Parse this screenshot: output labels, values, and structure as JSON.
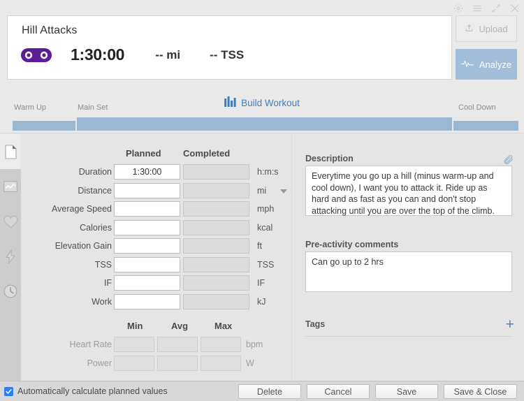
{
  "window": {
    "controls": [
      {
        "name": "gear-icon",
        "label": "Settings"
      },
      {
        "name": "menu-icon",
        "label": "Menu"
      },
      {
        "name": "expand-icon",
        "label": "Expand"
      },
      {
        "name": "close-icon",
        "label": "Close"
      }
    ]
  },
  "header": {
    "title": "Hill Attacks",
    "sport_icon": "bike-chain-icon",
    "sport_color": "#5b1e96",
    "duration": "1:30:00",
    "distance": "-- mi",
    "tss": "-- TSS",
    "upload_label": "Upload",
    "analyze_label": "Analyze",
    "analyze_color": "#a1bedb"
  },
  "workout_bar": {
    "build_label": "Build Workout",
    "build_color": "#3e7cba",
    "segments": [
      {
        "label": "Warm Up"
      },
      {
        "label": "Main Set"
      },
      {
        "label": "Cool Down"
      }
    ],
    "segment_color": "#9bb8d3"
  },
  "rail": {
    "items": [
      {
        "name": "document-icon",
        "label": "Summary",
        "active": true
      },
      {
        "name": "chart-icon",
        "label": "Graphs",
        "active": false
      },
      {
        "name": "heart-icon",
        "label": "Heart Rate",
        "active": false
      },
      {
        "name": "lightning-icon",
        "label": "Power",
        "active": false
      },
      {
        "name": "clock-icon",
        "label": "Time",
        "active": false
      }
    ]
  },
  "metrics": {
    "col_planned": "Planned",
    "col_completed": "Completed",
    "rows": [
      {
        "label": "Duration",
        "planned": "1:30:00",
        "completed": "",
        "unit": "h:m:s",
        "dropdown": false
      },
      {
        "label": "Distance",
        "planned": "",
        "completed": "",
        "unit": "mi",
        "dropdown": true
      },
      {
        "label": "Average Speed",
        "planned": "",
        "completed": "",
        "unit": "mph",
        "dropdown": false
      },
      {
        "label": "Calories",
        "planned": "",
        "completed": "",
        "unit": "kcal",
        "dropdown": false
      },
      {
        "label": "Elevation Gain",
        "planned": "",
        "completed": "",
        "unit": "ft",
        "dropdown": false
      },
      {
        "label": "TSS",
        "planned": "",
        "completed": "",
        "unit": "TSS",
        "dropdown": false
      },
      {
        "label": "IF",
        "planned": "",
        "completed": "",
        "unit": "IF",
        "dropdown": false
      },
      {
        "label": "Work",
        "planned": "",
        "completed": "",
        "unit": "kJ",
        "dropdown": false
      }
    ],
    "mam_headers": [
      "Min",
      "Avg",
      "Max"
    ],
    "mam_rows": [
      {
        "label": "Heart Rate",
        "min": "",
        "avg": "",
        "max": "",
        "unit": "bpm"
      },
      {
        "label": "Power",
        "min": "",
        "avg": "",
        "max": "",
        "unit": "W"
      }
    ]
  },
  "details": {
    "description_title": "Description",
    "description_value": "Everytime you go up a hill (minus warm-up and cool down), I want you to attack it. Ride up as hard and as fast as you can and don't stop attacking until you are over the top of the climb.",
    "attachment_icon": "paperclip-icon",
    "comments_title": "Pre-activity comments",
    "comments_value": "Can go up to 2 hrs",
    "tags_title": "Tags",
    "tags_add_label": "+",
    "tags_add_color": "#4a86c8"
  },
  "footer": {
    "autocalc_label": "Automatically calculate planned values",
    "autocalc_checked": true,
    "checkbox_color": "#2d7ff0",
    "buttons": [
      {
        "label": "Delete",
        "name": "delete-button"
      },
      {
        "label": "Cancel",
        "name": "cancel-button"
      },
      {
        "label": "Save",
        "name": "save-button"
      },
      {
        "label": "Save & Close",
        "name": "save-close-button"
      }
    ]
  }
}
